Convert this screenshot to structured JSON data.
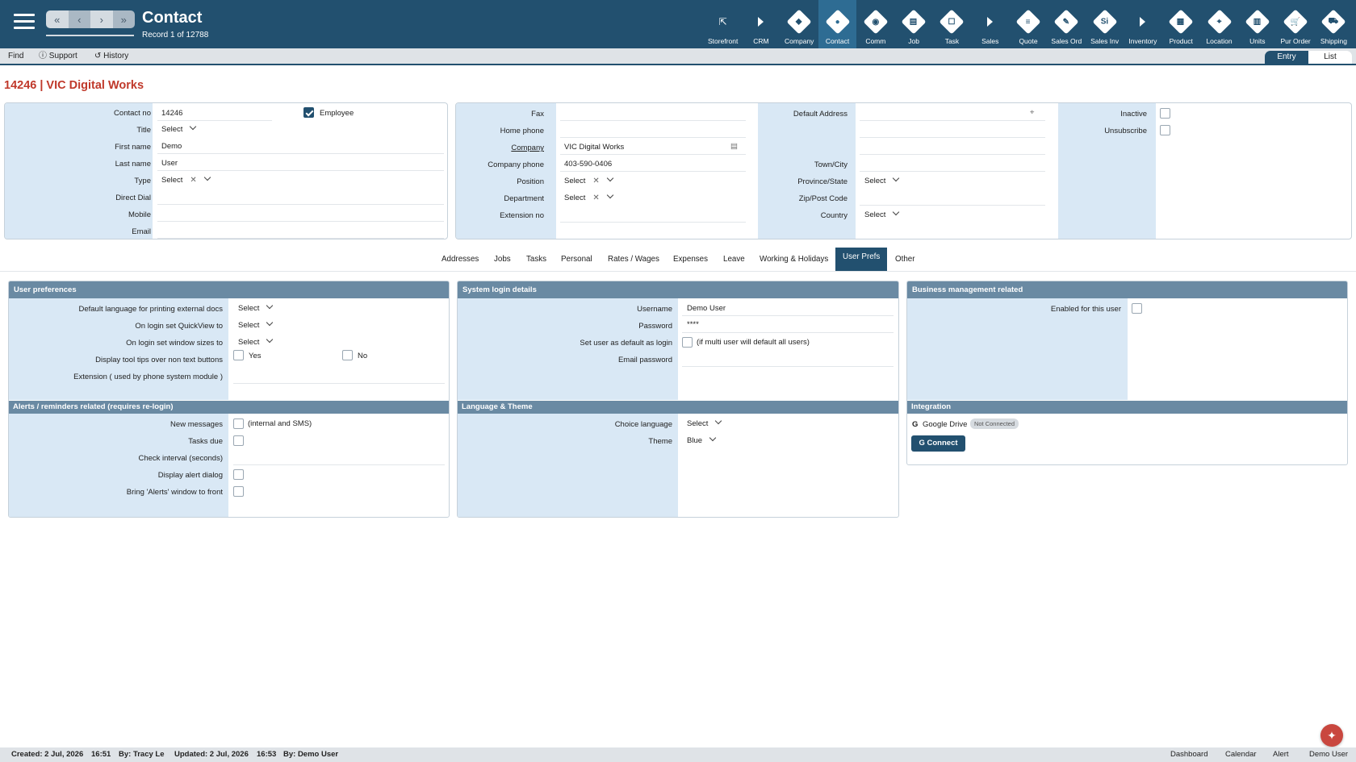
{
  "header": {
    "title": "Contact",
    "record": "Record 1 of 12788"
  },
  "nav_buttons": [
    "«",
    "‹",
    "›",
    "»"
  ],
  "modules": [
    {
      "label": "Storefront",
      "icon": "external-link-icon",
      "kind": "plain"
    },
    {
      "label": "CRM",
      "icon": "caret-right-icon",
      "kind": "tri"
    },
    {
      "label": "Company",
      "icon": "company-icon",
      "kind": "dia",
      "glyph": "◆"
    },
    {
      "label": "Contact",
      "icon": "contact-icon",
      "kind": "dia",
      "glyph": "●",
      "active": true
    },
    {
      "label": "Comm",
      "icon": "comm-icon",
      "kind": "dia",
      "glyph": "◉"
    },
    {
      "label": "Job",
      "icon": "job-icon",
      "kind": "dia",
      "glyph": "▤"
    },
    {
      "label": "Task",
      "icon": "task-icon",
      "kind": "dia",
      "glyph": "☐"
    },
    {
      "label": "Sales",
      "icon": "caret-right-icon",
      "kind": "tri"
    },
    {
      "label": "Quote",
      "icon": "quote-icon",
      "kind": "dia",
      "glyph": "≡"
    },
    {
      "label": "Sales Ord",
      "icon": "sales-order-icon",
      "kind": "dia",
      "glyph": "✎"
    },
    {
      "label": "Sales Inv",
      "icon": "sales-invoice-icon",
      "kind": "dia",
      "glyph": "Si"
    },
    {
      "label": "Inventory",
      "icon": "caret-right-icon",
      "kind": "tri"
    },
    {
      "label": "Product",
      "icon": "product-icon",
      "kind": "dia",
      "glyph": "▦"
    },
    {
      "label": "Location",
      "icon": "location-icon",
      "kind": "dia",
      "glyph": "⌖"
    },
    {
      "label": "Units",
      "icon": "units-icon",
      "kind": "dia",
      "glyph": "▥"
    },
    {
      "label": "Pur Order",
      "icon": "purchase-order-icon",
      "kind": "dia",
      "glyph": "🛒"
    },
    {
      "label": "Shipping",
      "icon": "shipping-icon",
      "kind": "dia",
      "glyph": "⛟"
    }
  ],
  "toolbar": {
    "find": "Find",
    "support": "Support",
    "history": "History",
    "entry": "Entry",
    "list": "List"
  },
  "record_title": "14246 | VIC Digital Works",
  "contact": {
    "contact_no_label": "Contact no",
    "contact_no": "14246",
    "employee_label": "Employee",
    "title_label": "Title",
    "title": "Select",
    "first_name_label": "First name",
    "first_name": "Demo",
    "last_name_label": "Last name",
    "last_name": "User",
    "type_label": "Type",
    "type": "Select",
    "direct_dial_label": "Direct Dial",
    "mobile_label": "Mobile",
    "email_label": "Email",
    "fax_label": "Fax",
    "home_phone_label": "Home phone",
    "company_label": "Company",
    "company": "VIC Digital Works",
    "company_phone_label": "Company phone",
    "company_phone": "403-590-0406",
    "position_label": "Position",
    "position": "Select",
    "department_label": "Department",
    "department": "Select",
    "extension_label": "Extension no",
    "default_address_label": "Default Address",
    "town_label": "Town/City",
    "province_label": "Province/State",
    "province": "Select",
    "zip_label": "Zip/Post Code",
    "country_label": "Country",
    "country": "Select",
    "inactive_label": "Inactive",
    "unsubscribe_label": "Unsubscribe"
  },
  "tabs": [
    "Addresses",
    "Jobs",
    "Tasks",
    "Personal",
    "Rates / Wages",
    "Expenses",
    "Leave",
    "Working & Holidays",
    "User Prefs",
    "Other"
  ],
  "active_tab": "User Prefs",
  "user_prefs": {
    "title": "User preferences",
    "lang_label": "Default language for printing external docs",
    "lang": "Select",
    "quickview_label": "On login set QuickView to",
    "quickview": "Select",
    "window_label": "On login set window sizes to",
    "window": "Select",
    "tooltips_label": "Display tool tips over non text buttons",
    "yes": "Yes",
    "no": "No",
    "extension_label": "Extension ( used by phone system module )"
  },
  "system_login": {
    "title": "System login details",
    "username_label": "Username",
    "username": "Demo User",
    "password_label": "Password",
    "password": "****",
    "default_login_label": "Set user as default as login",
    "default_login_note": "(if multi user will default all users)",
    "email_password_label": "Email password"
  },
  "business": {
    "title": "Business management related",
    "enabled_label": "Enabled for this user"
  },
  "alerts": {
    "title": "Alerts / reminders related (requires re-login)",
    "new_messages_label": "New messages",
    "new_messages_note": "(internal and SMS)",
    "tasks_due_label": "Tasks due",
    "interval_label": "Check interval (seconds)",
    "alert_dialog_label": "Display alert dialog",
    "bring_front_label": "Bring 'Alerts' window to front"
  },
  "language_theme": {
    "title": "Language & Theme",
    "choice_label": "Choice language",
    "choice": "Select",
    "theme_label": "Theme",
    "theme": "Blue"
  },
  "integration": {
    "title": "Integration",
    "service": "Google Drive",
    "status": "Not Connected",
    "connect": "Connect"
  },
  "status_bar": {
    "created": "Created: 2 Jul, 2026",
    "created_time": "16:51",
    "created_by": "By: Tracy Le",
    "updated": "Updated: 2 Jul, 2026",
    "updated_time": "16:53",
    "updated_by": "By: Demo User",
    "links": [
      "Dashboard",
      "Calendar",
      "Alert",
      "Demo User"
    ]
  }
}
